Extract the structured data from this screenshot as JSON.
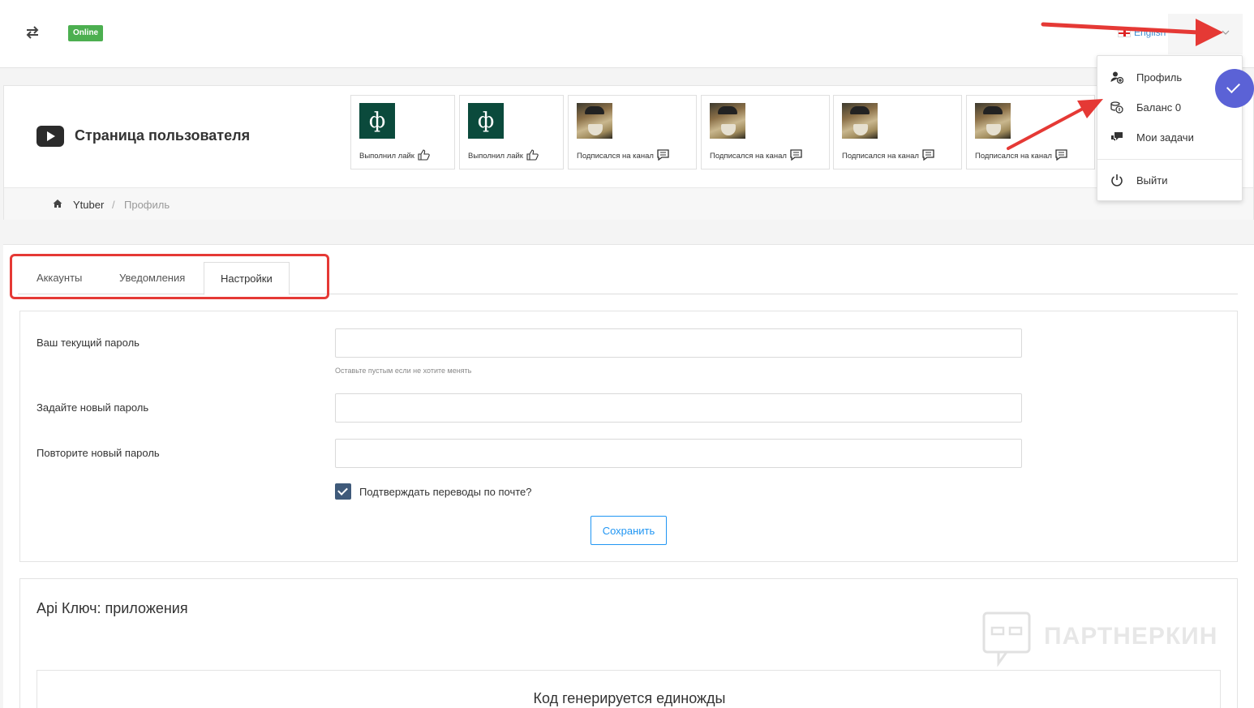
{
  "topbar": {
    "status_badge": "Online",
    "language": "English",
    "icons": [
      "swap-icon",
      "chevron-down-icon"
    ]
  },
  "header": {
    "page_title": "Страница пользователя",
    "activities": [
      {
        "type": "like",
        "label": "Выполнил лайк",
        "image": "ф"
      },
      {
        "type": "like",
        "label": "Выполнил лайк",
        "image": "ф"
      },
      {
        "type": "subscribe",
        "label": "Подписался на канал"
      },
      {
        "type": "subscribe",
        "label": "Подписался на канал"
      },
      {
        "type": "subscribe",
        "label": "Подписался на канал"
      },
      {
        "type": "subscribe",
        "label": "Подписался на канал"
      }
    ]
  },
  "breadcrumb": {
    "home": "Ytuber",
    "separator": "/",
    "current": "Профиль"
  },
  "tabs": [
    {
      "label": "Аккаунты",
      "active": false
    },
    {
      "label": "Уведомления",
      "active": false
    },
    {
      "label": "Настройки",
      "active": true
    }
  ],
  "settings": {
    "current_password_label": "Ваш текущий пароль",
    "current_password_hint": "Оставьте пустым если не хотите менять",
    "new_password_label": "Задайте новый пароль",
    "repeat_password_label": "Повторите новый пароль",
    "confirm_transfers_label": "Подтверждать переводы по почте?",
    "confirm_transfers_checked": true,
    "save_label": "Сохранить"
  },
  "api": {
    "title": "Api Ключ: приложения",
    "note": "Код генерируется единожды"
  },
  "watermark": "ПАРТНЕРКИН",
  "dropdown": {
    "items": [
      {
        "label": "Профиль",
        "icon": "add-user-icon"
      },
      {
        "label": "Баланс 0",
        "icon": "coins-icon"
      },
      {
        "label": "Мои задачи",
        "icon": "chat-icon"
      },
      {
        "label": "Выйти",
        "icon": "power-icon"
      }
    ]
  },
  "colors": {
    "accent": "#2196f3",
    "online": "#4caf50",
    "annotation": "#e53935",
    "fab": "#5b62d6"
  }
}
